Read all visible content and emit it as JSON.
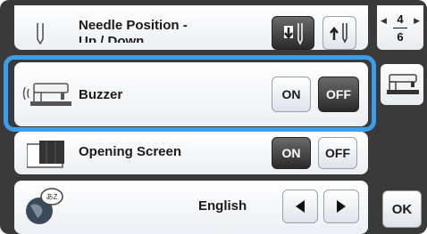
{
  "settings": {
    "needle_position": {
      "label_line1": "Needle Position -",
      "label_line2": "Up / Down"
    },
    "buzzer": {
      "label": "Buzzer",
      "on_label": "ON",
      "off_label": "OFF"
    },
    "opening_screen": {
      "label": "Opening Screen",
      "on_label": "ON",
      "off_label": "OFF"
    },
    "language": {
      "value": "English"
    }
  },
  "pager": {
    "current": "4",
    "total": "6"
  },
  "ok_label": "OK",
  "icons": {
    "needle": "needle-icon",
    "buzzer_machine": "sewing-machine-sound-icon",
    "opening_screen": "screen-thumbnail-icon",
    "globe": "globe-speech-icon",
    "needle_down": "needle-down-icon",
    "needle_up": "needle-up-icon",
    "machine_side": "sewing-machine-icon"
  },
  "colors": {
    "highlight": "#3a9ee8",
    "frame": "#3a3a3a"
  }
}
